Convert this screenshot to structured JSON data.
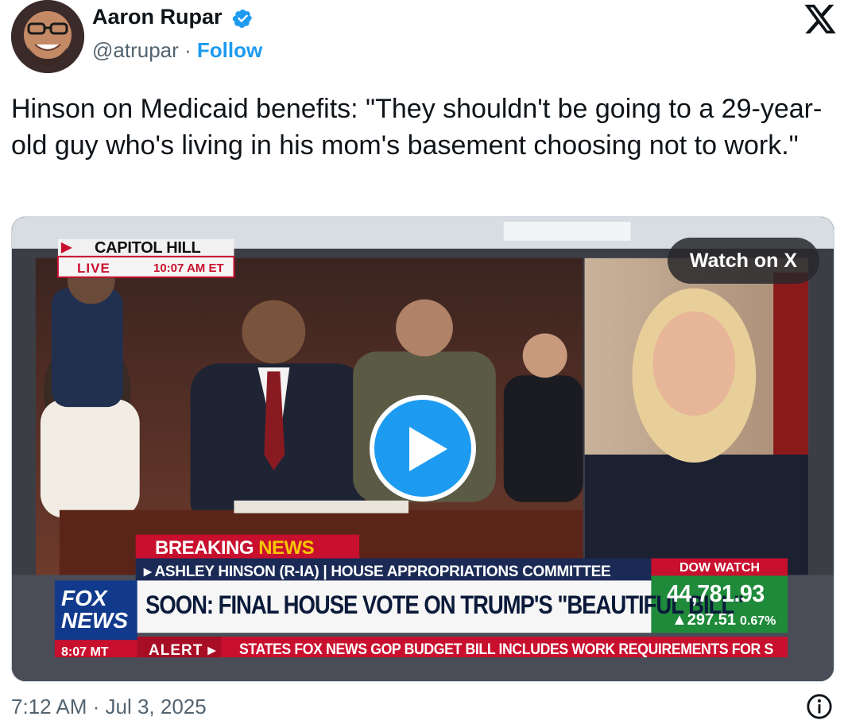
{
  "author": {
    "name": "Aaron Rupar",
    "handle": "@atrupar",
    "separator": "·",
    "follow_label": "Follow",
    "verified_color": "#1d9bf0"
  },
  "tweet": {
    "text": "Hinson on Medicaid benefits: \"They shouldn't be going to a 29-year-old guy who's living in his mom's basement choosing not to work.\""
  },
  "media": {
    "watch_label": "Watch on X",
    "play_icon": "play-icon",
    "chyron": {
      "location": "CAPITOL HILL",
      "live": "LIVE",
      "live_time": "10:07 AM ET",
      "breaking_word": "BREAKING",
      "breaking_news": "NEWS",
      "lower_third_name": "▸ ASHLEY HINSON (R-IA) | HOUSE APPROPRIATIONS COMMITTEE",
      "headline": "SOON: FINAL HOUSE VOTE ON TRUMP'S \"BEAUTIFUL BILL\"",
      "dow_label": "DOW WATCH",
      "dow_value": "44,781.93",
      "dow_change": "▲297.51",
      "dow_pct": "0.67%",
      "network_line1": "FOX",
      "network_line2": "NEWS",
      "network_time": "8:07 MT",
      "alert_label": "ALERT ▸",
      "ticker": "STATES  FOX NEWS  GOP BUDGET BILL INCLUDES WORK REQUIREMENTS FOR S"
    }
  },
  "footer": {
    "timestamp": "7:12 AM · Jul 3, 2025",
    "info_icon": "info-icon"
  },
  "colors": {
    "accent": "#1d9bf0",
    "text_primary": "#0f1419",
    "text_secondary": "#536471",
    "fox_red": "#c8102e",
    "fox_navy": "#0b1a3a",
    "dow_green": "#1e8a3a"
  }
}
